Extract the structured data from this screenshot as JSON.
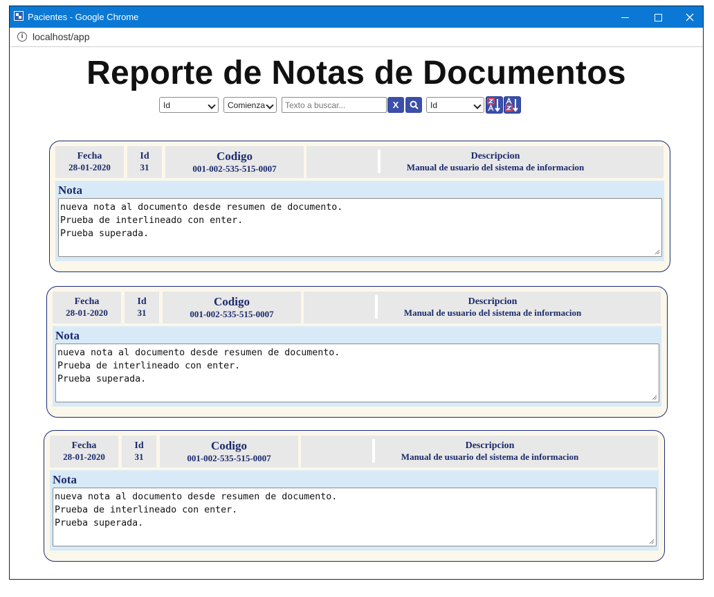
{
  "window": {
    "title": "Pacientes - Google Chrome"
  },
  "address": {
    "url": "localhost/app"
  },
  "page": {
    "title": "Reporte de Notas de Documentos"
  },
  "controls": {
    "field_select": "Id",
    "mode_select": "Comienza",
    "search_placeholder": "Texto a buscar...",
    "clear_label": "X",
    "order_select": "Id"
  },
  "labels": {
    "fecha": "Fecha",
    "id": "Id",
    "codigo": "Codigo",
    "descripcion": "Descripcion",
    "nota": "Nota"
  },
  "records": [
    {
      "fecha": "28-01-2020",
      "id": "31",
      "codigo": "001-002-535-515-0007",
      "descripcion": "Manual de usuario del sistema de informacion",
      "nota_lines": [
        "nueva nota al documento desde resumen de documento.",
        "Prueba de interlineado con enter.",
        "Prueba superada."
      ]
    },
    {
      "fecha": "28-01-2020",
      "id": "31",
      "codigo": "001-002-535-515-0007",
      "descripcion": "Manual de usuario del sistema de informacion",
      "nota_lines": [
        "nueva nota al documento desde resumen de documento.",
        "Prueba de interlineado con enter.",
        "Prueba superada."
      ]
    },
    {
      "fecha": "28-01-2020",
      "id": "31",
      "codigo": "001-002-535-515-0007",
      "descripcion": "Manual de usuario del sistema de informacion",
      "nota_lines": [
        "nueva nota al documento desde resumen de documento.",
        "Prueba de interlineado con enter.",
        "Prueba superada."
      ]
    }
  ]
}
